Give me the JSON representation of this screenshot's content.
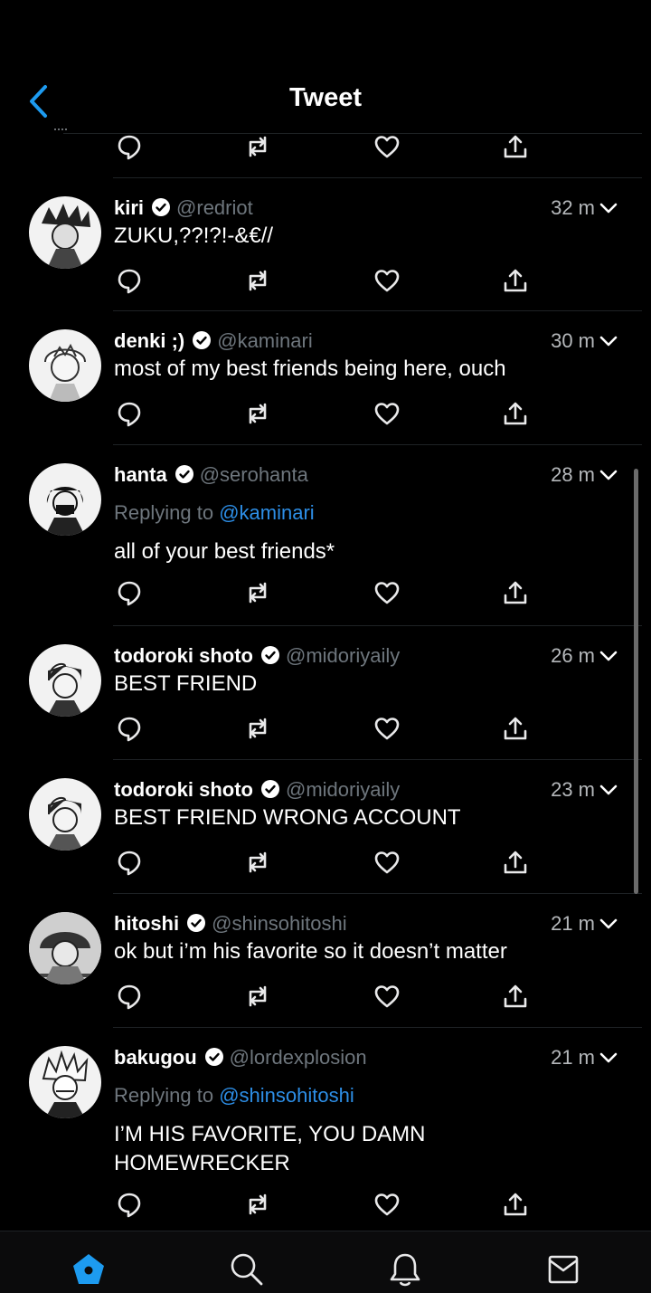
{
  "header": {
    "title": "Tweet"
  },
  "tweets": [
    {
      "name": "kiri",
      "handle": "@redriot",
      "time": "32 m",
      "reply_label": "",
      "reply_to": "",
      "lines": [
        "ZUKU,??!?!-&€//"
      ]
    },
    {
      "name": "denki ;)",
      "handle": "@kaminari",
      "time": "30 m",
      "reply_label": "",
      "reply_to": "",
      "lines": [
        "most of my best friends being here, ouch"
      ]
    },
    {
      "name": "hanta",
      "handle": "@serohanta",
      "time": "28 m",
      "reply_label": "Replying to",
      "reply_to": "@kaminari",
      "lines": [
        "all of your best friends*"
      ]
    },
    {
      "name": "todoroki shoto",
      "handle": "@midoriyaily",
      "time": "26 m",
      "reply_label": "",
      "reply_to": "",
      "lines": [
        "BEST FRIEND"
      ]
    },
    {
      "name": "todoroki shoto",
      "handle": "@midoriyaily",
      "time": "23 m",
      "reply_label": "",
      "reply_to": "",
      "lines": [
        "BEST FRIEND WRONG ACCOUNT"
      ]
    },
    {
      "name": "hitoshi",
      "handle": "@shinsohitoshi",
      "time": "21 m",
      "reply_label": "",
      "reply_to": "",
      "lines": [
        "ok but i’m his favorite so it doesn’t matter"
      ]
    },
    {
      "name": "bakugou",
      "handle": "@lordexplosion",
      "time": "21 m",
      "reply_label": "Replying to",
      "reply_to": "@shinsohitoshi",
      "lines": [
        "I’M HIS FAVORITE, YOU DAMN",
        "HOMEWRECKER"
      ]
    }
  ],
  "tabbar": {
    "items": [
      "home-icon",
      "search-icon",
      "bell-icon",
      "mail-icon"
    ],
    "active": "home-icon"
  },
  "colors": {
    "accent": "#1d9bf0",
    "background": "#000000",
    "muted": "#6e767d",
    "text": "#ffffff"
  }
}
